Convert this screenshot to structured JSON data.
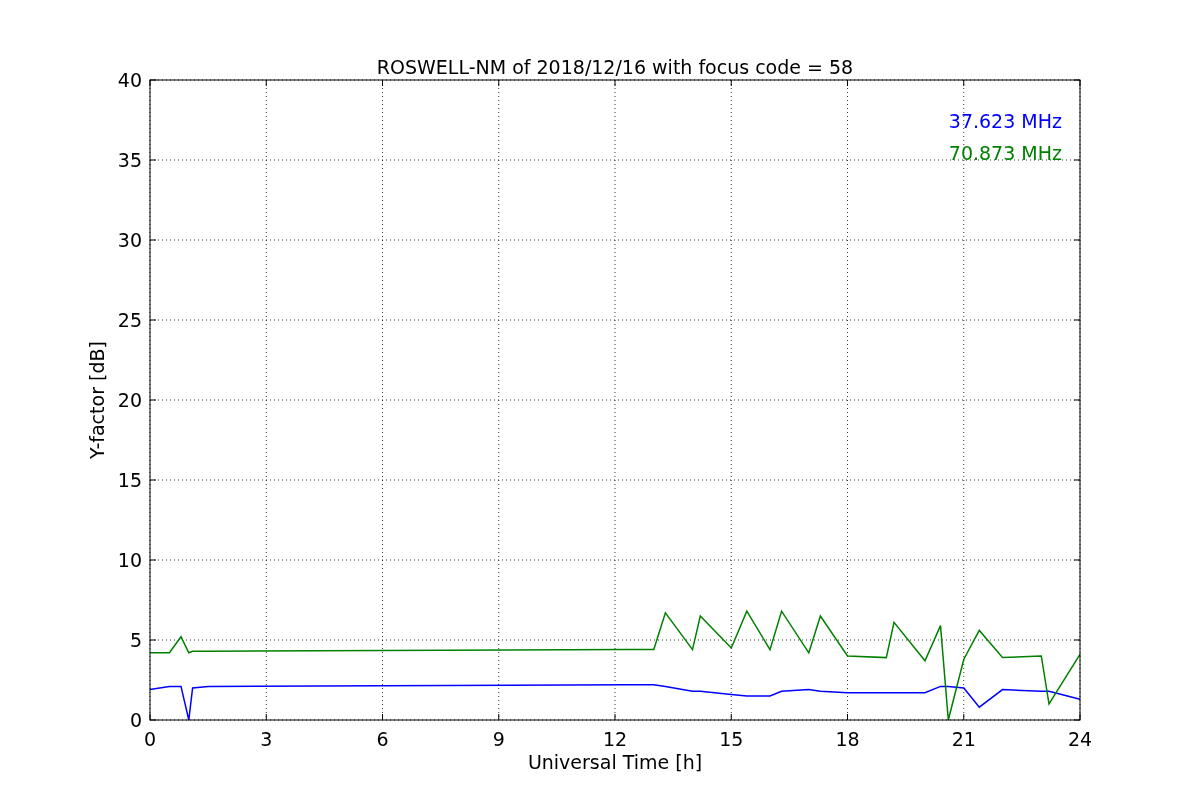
{
  "chart_data": {
    "type": "line",
    "title": "ROSWELL-NM of 2018/12/16 with focus code = 58",
    "xlabel": "Universal Time [h]",
    "ylabel": "Y-factor [dB]",
    "x": [
      0,
      0.5,
      0.8,
      1.0,
      1.1,
      1.5,
      12.3,
      13,
      13.3,
      14,
      14.2,
      15,
      15.4,
      16,
      16.3,
      17,
      17.3,
      18,
      19,
      19.2,
      20,
      20.4,
      20.6,
      21,
      21.4,
      22,
      23,
      23.2,
      24
    ],
    "series": [
      {
        "name": "37.623 MHz",
        "color": "#0000ff",
        "values": [
          1.9,
          2.1,
          2.1,
          0.0,
          2.0,
          2.1,
          2.2,
          2.2,
          2.1,
          1.8,
          1.8,
          1.6,
          1.5,
          1.5,
          1.8,
          1.9,
          1.8,
          1.7,
          1.7,
          1.7,
          1.7,
          2.1,
          2.1,
          2.0,
          0.8,
          1.9,
          1.8,
          1.8,
          1.3
        ]
      },
      {
        "name": "70.873 MHz",
        "color": "#008000",
        "values": [
          4.2,
          4.2,
          5.2,
          4.2,
          4.3,
          4.3,
          4.4,
          4.4,
          6.7,
          4.4,
          6.5,
          4.5,
          6.8,
          4.4,
          6.8,
          4.2,
          6.5,
          4.0,
          3.9,
          6.1,
          3.7,
          5.9,
          0.0,
          3.8,
          5.6,
          3.9,
          4.0,
          1.0,
          4.1
        ]
      }
    ],
    "grid": true,
    "xlim": [
      0,
      24
    ],
    "ylim": [
      0,
      40
    ],
    "xticks": [
      0,
      3,
      6,
      9,
      12,
      15,
      18,
      21,
      24
    ],
    "yticks": [
      0,
      5,
      10,
      15,
      20,
      25,
      30,
      35,
      40
    ]
  }
}
